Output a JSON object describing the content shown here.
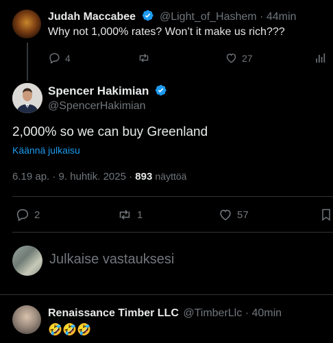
{
  "parent_tweet": {
    "display_name": "Judah Maccabee",
    "handle": "@Light_of_Hashem",
    "separator": "·",
    "time": "44min",
    "text": "Why not 1,000% rates? Won’t it make us rich???",
    "reply_count": "4",
    "like_count": "27"
  },
  "main_tweet": {
    "display_name": "Spencer Hakimian",
    "handle": "@SpencerHakimian",
    "text": "2,000% so we can buy Greenland",
    "translate_link": "Käännä julkaisu",
    "timestamp": "6.19 ap. · 9. huhtik. 2025 ·",
    "views_count": "893",
    "views_label": "näyttöä",
    "reply_count": "2",
    "repost_count": "1",
    "like_count": "57"
  },
  "reply_box": {
    "placeholder": "Julkaise vastauksesi"
  },
  "reply_tweet": {
    "display_name": "Renaissance Timber LLC",
    "handle": "@TimberLlc",
    "separator": "·",
    "time": "40min",
    "text": "🤣🤣🤣"
  },
  "colors": {
    "background": "#000000",
    "text": "#e7e9ea",
    "muted": "#71767b",
    "link": "#1d9bf0",
    "verified": "#1d9bf0",
    "divider": "#2f3336"
  }
}
